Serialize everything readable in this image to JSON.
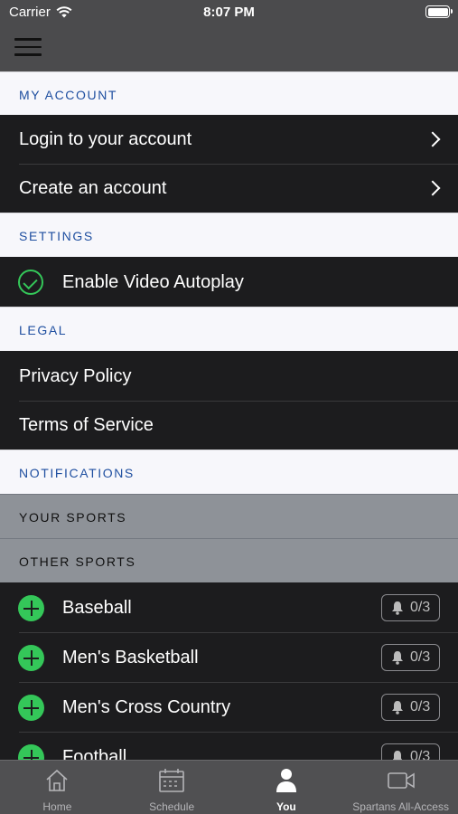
{
  "status": {
    "carrier": "Carrier",
    "time": "8:07 PM"
  },
  "sections": {
    "account": "MY ACCOUNT",
    "settings": "SETTINGS",
    "legal": "LEGAL",
    "notifications": "NOTIFICATIONS",
    "your_sports": "YOUR SPORTS",
    "other_sports": "OTHER SPORTS"
  },
  "account_items": [
    "Login to your account",
    "Create an account"
  ],
  "settings_items": {
    "autoplay": "Enable Video Autoplay"
  },
  "legal_items": [
    "Privacy Policy",
    "Terms of Service"
  ],
  "sports": [
    {
      "name": "Baseball",
      "badge": "0/3"
    },
    {
      "name": "Men's Basketball",
      "badge": "0/3"
    },
    {
      "name": "Men's Cross Country",
      "badge": "0/3"
    },
    {
      "name": "Football",
      "badge": "0/3"
    }
  ],
  "tabs": [
    {
      "label": "Home",
      "icon": "home-icon"
    },
    {
      "label": "Schedule",
      "icon": "calendar-icon"
    },
    {
      "label": "You",
      "icon": "person-icon"
    },
    {
      "label": "Spartans All-Access",
      "icon": "video-icon"
    }
  ],
  "colors": {
    "accent": "#1f4fa0",
    "green": "#34c759",
    "nav_bg": "#4b4b4d"
  }
}
